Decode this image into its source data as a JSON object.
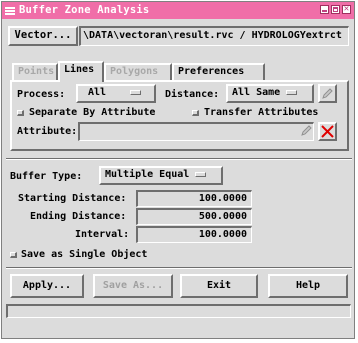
{
  "window": {
    "title": "Buffer Zone Analysis"
  },
  "vector": {
    "button_label": "Vector...",
    "path": "\\DATA\\vectoran\\result.rvc / HYDROLOGYextrct"
  },
  "tabs": [
    {
      "label": "Points",
      "enabled": false
    },
    {
      "label": "Lines",
      "enabled": true,
      "active": true
    },
    {
      "label": "Polygons",
      "enabled": false
    },
    {
      "label": "Preferences",
      "enabled": true
    }
  ],
  "lines_tab": {
    "process_label": "Process:",
    "process_value": "All",
    "distance_label": "Distance:",
    "distance_value": "All Same",
    "separate_by_attribute": {
      "label": "Separate By Attribute",
      "checked": false
    },
    "transfer_attributes": {
      "label": "Transfer Attributes",
      "checked": false
    },
    "attribute_label": "Attribute:",
    "attribute_value": ""
  },
  "buffer": {
    "type_label": "Buffer Type:",
    "type_value": "Multiple Equal",
    "starting_distance_label": "Starting Distance:",
    "starting_distance_value": "100.0000",
    "ending_distance_label": "Ending Distance:",
    "ending_distance_value": "500.0000",
    "interval_label": "Interval:",
    "interval_value": "100.0000",
    "save_single": {
      "label": "Save as Single Object",
      "checked": false
    }
  },
  "actions": {
    "apply": "Apply...",
    "save_as": "Save As...",
    "exit": "Exit",
    "help": "Help"
  },
  "colors": {
    "titlebar": "#f06ea8",
    "dialog_bg": "#dcdcdc",
    "delete_x": "#e00000"
  }
}
